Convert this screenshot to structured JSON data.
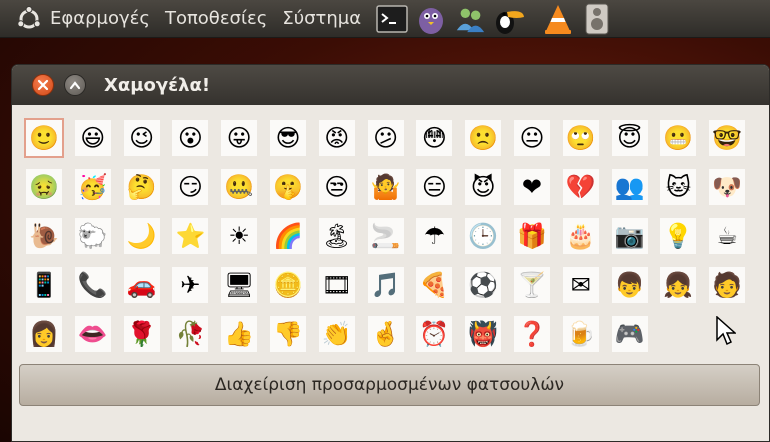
{
  "panel": {
    "menus": [
      "Εφαρμογές",
      "Τοποθεσίες",
      "Σύστημα"
    ],
    "launchers": [
      {
        "name": "terminal-icon",
        "glyph": ">_"
      },
      {
        "name": "pidgin-icon",
        "glyph": "🐦"
      },
      {
        "name": "people-icon",
        "glyph": "👥"
      },
      {
        "name": "toucan-icon",
        "glyph": "🐦"
      },
      {
        "name": "vlc-icon",
        "glyph": "🔺"
      },
      {
        "name": "speaker-icon",
        "glyph": "🔊"
      }
    ]
  },
  "window": {
    "title": "Χαμογέλα!",
    "close_icon": "close-icon",
    "maximize_icon": "chevron-up-icon"
  },
  "smileys": [
    {
      "name": "smile-icon",
      "glyph": "🙂"
    },
    {
      "name": "big-grin-icon",
      "glyph": "😃"
    },
    {
      "name": "wink-icon",
      "glyph": "😉"
    },
    {
      "name": "surprised-icon",
      "glyph": "😮"
    },
    {
      "name": "tongue-icon",
      "glyph": "😛"
    },
    {
      "name": "sunglasses-icon",
      "glyph": "😎"
    },
    {
      "name": "angry-icon",
      "glyph": "😡"
    },
    {
      "name": "confused-icon",
      "glyph": "😕"
    },
    {
      "name": "embarrassed-icon",
      "glyph": "😳"
    },
    {
      "name": "sad-icon",
      "glyph": "🙁"
    },
    {
      "name": "neutral-icon",
      "glyph": "😐"
    },
    {
      "name": "eye-roll-icon",
      "glyph": "🙄"
    },
    {
      "name": "angel-icon",
      "glyph": "😇"
    },
    {
      "name": "grimace-icon",
      "glyph": "😬"
    },
    {
      "name": "nerd-icon",
      "glyph": "🤓"
    },
    {
      "name": "sick-icon",
      "glyph": "🤢"
    },
    {
      "name": "party-icon",
      "glyph": "🥳"
    },
    {
      "name": "thinking-icon",
      "glyph": "🤔"
    },
    {
      "name": "sarcastic-icon",
      "glyph": "😏"
    },
    {
      "name": "secret-icon",
      "glyph": "🤐"
    },
    {
      "name": "whisper-icon",
      "glyph": "🤫"
    },
    {
      "name": "disgusted-icon",
      "glyph": "😒"
    },
    {
      "name": "dont-know-icon",
      "glyph": "🤷"
    },
    {
      "name": "sleepy-icon",
      "glyph": "😑"
    },
    {
      "name": "devil-icon",
      "glyph": "😈"
    },
    {
      "name": "heart-icon",
      "glyph": "❤"
    },
    {
      "name": "broken-heart-icon",
      "glyph": "💔"
    },
    {
      "name": "messenger-icon",
      "glyph": "👥"
    },
    {
      "name": "cat-icon",
      "glyph": "🐱"
    },
    {
      "name": "dog-icon",
      "glyph": "🐶"
    },
    {
      "name": "snail-icon",
      "glyph": "🐌"
    },
    {
      "name": "sheep-icon",
      "glyph": "🐑"
    },
    {
      "name": "moon-icon",
      "glyph": "🌙"
    },
    {
      "name": "star-icon",
      "glyph": "⭐"
    },
    {
      "name": "sun-icon",
      "glyph": "☀"
    },
    {
      "name": "rainbow-icon",
      "glyph": "🌈"
    },
    {
      "name": "island-icon",
      "glyph": "🏝"
    },
    {
      "name": "cigarette-icon",
      "glyph": "🚬"
    },
    {
      "name": "umbrella-icon",
      "glyph": "☂"
    },
    {
      "name": "clock-icon",
      "glyph": "🕒"
    },
    {
      "name": "gift-icon",
      "glyph": "🎁"
    },
    {
      "name": "cake-icon",
      "glyph": "🎂"
    },
    {
      "name": "camera-icon",
      "glyph": "📷"
    },
    {
      "name": "lightbulb-icon",
      "glyph": "💡"
    },
    {
      "name": "coffee-icon",
      "glyph": "☕"
    },
    {
      "name": "mobile-phone-icon",
      "glyph": "📱"
    },
    {
      "name": "telephone-icon",
      "glyph": "📞"
    },
    {
      "name": "car-icon",
      "glyph": "🚗"
    },
    {
      "name": "airplane-icon",
      "glyph": "✈"
    },
    {
      "name": "computer-icon",
      "glyph": "🖥"
    },
    {
      "name": "coins-icon",
      "glyph": "🪙"
    },
    {
      "name": "film-icon",
      "glyph": "🎞"
    },
    {
      "name": "music-note-icon",
      "glyph": "🎵"
    },
    {
      "name": "pizza-icon",
      "glyph": "🍕"
    },
    {
      "name": "soccer-ball-icon",
      "glyph": "⚽"
    },
    {
      "name": "cocktail-icon",
      "glyph": "🍸"
    },
    {
      "name": "email-icon",
      "glyph": "✉"
    },
    {
      "name": "boy-icon",
      "glyph": "👦"
    },
    {
      "name": "girl-icon",
      "glyph": "👧"
    },
    {
      "name": "man-at-computer-icon",
      "glyph": "🧑"
    },
    {
      "name": "woman-at-computer-icon",
      "glyph": "👩"
    },
    {
      "name": "lips-icon",
      "glyph": "👄"
    },
    {
      "name": "rose-icon",
      "glyph": "🌹"
    },
    {
      "name": "wilted-rose-icon",
      "glyph": "🥀"
    },
    {
      "name": "thumbs-up-icon",
      "glyph": "👍"
    },
    {
      "name": "thumbs-down-icon",
      "glyph": "👎"
    },
    {
      "name": "clap-icon",
      "glyph": "👏"
    },
    {
      "name": "crossed-fingers-icon",
      "glyph": "🤞"
    },
    {
      "name": "be-right-back-icon",
      "glyph": "⏰"
    },
    {
      "name": "devil-face-icon",
      "glyph": "👹"
    },
    {
      "name": "asl-icon",
      "glyph": "❓"
    },
    {
      "name": "beer-icon",
      "glyph": "🍺"
    },
    {
      "name": "console-icon",
      "glyph": "🎮"
    }
  ],
  "manage_button": "Διαχείριση προσαρμοσμένων φατσουλών"
}
